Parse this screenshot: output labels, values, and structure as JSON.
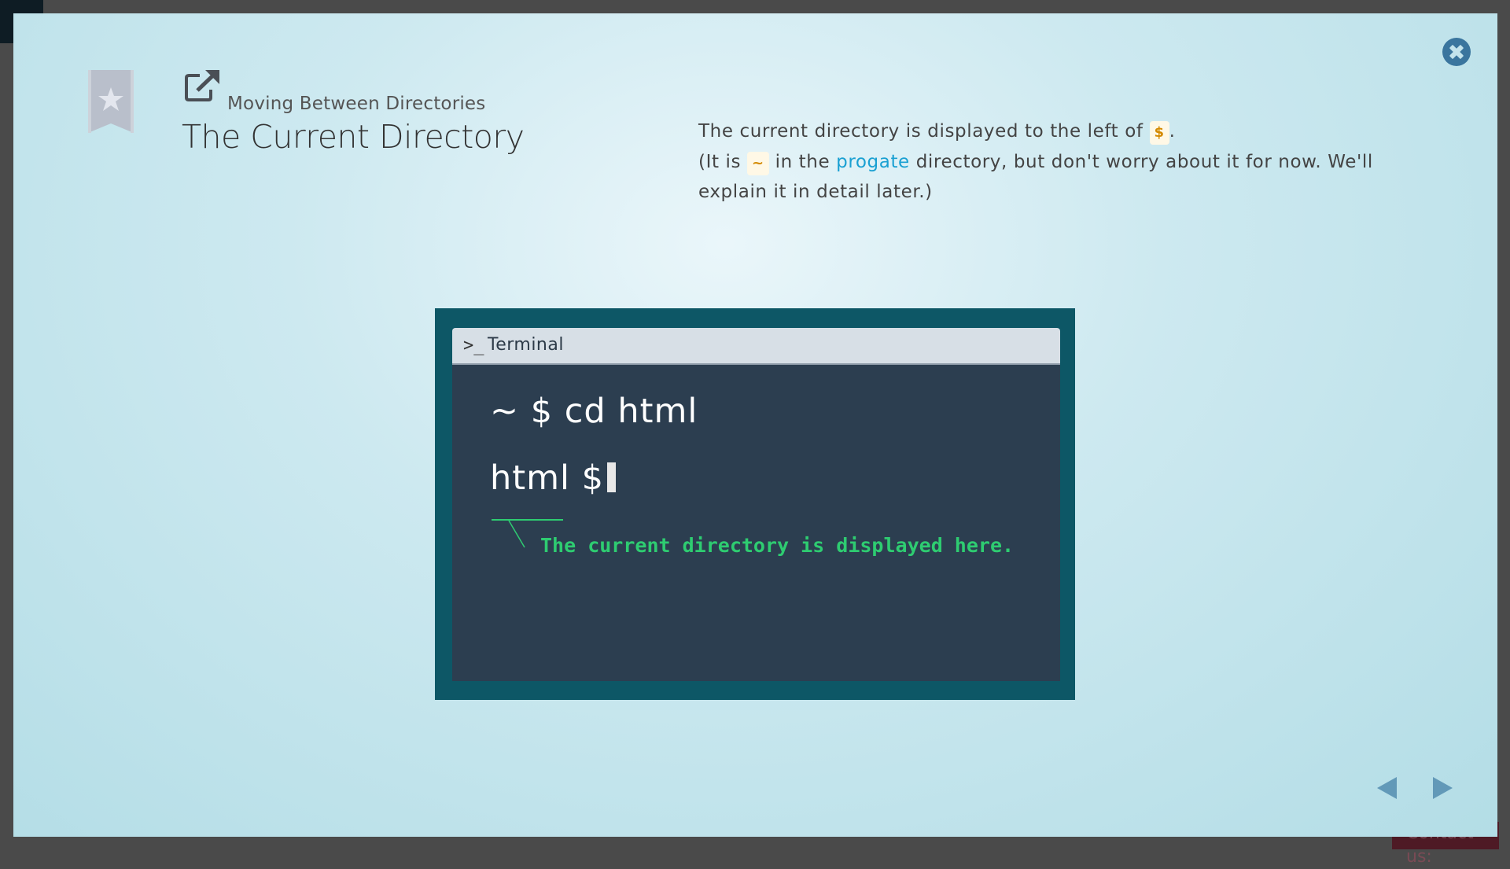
{
  "background": {
    "contact_label": "Contact us:"
  },
  "header": {
    "section_label": "Moving Between Directories",
    "title": "The Current Directory",
    "bookmark_icon": "star-bookmark-icon",
    "link_icon": "external-link-icon"
  },
  "description": {
    "line1_before": "The current directory is displayed to the left of ",
    "line1_code": "$",
    "line1_after": ".",
    "line2_before": "(It is ",
    "line2_code": "~",
    "line2_middle": " in the ",
    "line2_link": "progate",
    "line2_after": " directory, but don't worry about it for now. We'll explain it in detail later.)"
  },
  "terminal": {
    "title": "Terminal",
    "prompt_icon": ">_",
    "line1": "~ $ cd html",
    "line2": "html $",
    "annotation": "The current directory is displayed here."
  },
  "controls": {
    "close_icon": "close-icon",
    "prev_icon": "triangle-left-icon",
    "next_icon": "triangle-right-icon"
  },
  "colors": {
    "accent": "#3a759e",
    "terminal_frame": "#0d5766",
    "terminal_bg": "#2c3e50",
    "annotation": "#2ecc71",
    "link": "#1aa0d2"
  }
}
